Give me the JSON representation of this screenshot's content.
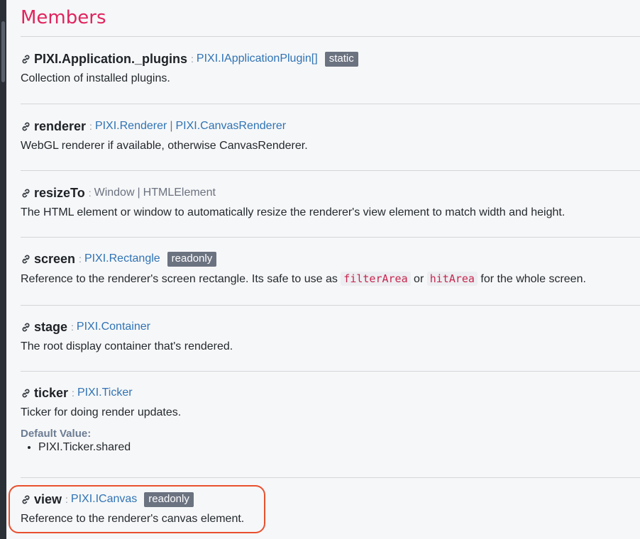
{
  "section": {
    "title": "Members"
  },
  "members": [
    {
      "name": "PIXI.Application._plugins",
      "separator": ":",
      "types": [
        "PIXI.IApplicationPlugin[]"
      ],
      "badge": "static",
      "description": "Collection of installed plugins."
    },
    {
      "name": "renderer",
      "separator": ":",
      "types": [
        "PIXI.Renderer",
        "PIXI.CanvasRenderer"
      ],
      "type_sep": "|",
      "description": "WebGL renderer if available, otherwise CanvasRenderer."
    },
    {
      "name": "resizeTo",
      "separator": ":",
      "types": [
        "Window",
        "HTMLElement"
      ],
      "type_sep": "|",
      "description": "The HTML element or window to automatically resize the renderer's view element to match width and height."
    },
    {
      "name": "screen",
      "separator": ":",
      "types": [
        "PIXI.Rectangle"
      ],
      "badge": "readonly",
      "description_parts": [
        "Reference to the renderer's screen rectangle. Its safe to use as ",
        "filterArea",
        " or ",
        "hitArea",
        " for the whole screen."
      ]
    },
    {
      "name": "stage",
      "separator": ":",
      "types": [
        "PIXI.Container"
      ],
      "description": "The root display container that's rendered."
    },
    {
      "name": "ticker",
      "separator": ":",
      "types": [
        "PIXI.Ticker"
      ],
      "description": "Ticker for doing render updates.",
      "default_label": "Default Value:",
      "default_values": [
        "PIXI.Ticker.shared"
      ]
    },
    {
      "name": "view",
      "separator": ":",
      "types": [
        "PIXI.ICanvas"
      ],
      "badge": "readonly",
      "description": "Reference to the renderer's canvas element."
    }
  ],
  "icons": {
    "member_link": "link-icon"
  },
  "colors": {
    "section_title": "#e0245e",
    "type_link": "#2f73b5",
    "badge_bg": "#6b7280",
    "highlight": "#e8502f"
  }
}
